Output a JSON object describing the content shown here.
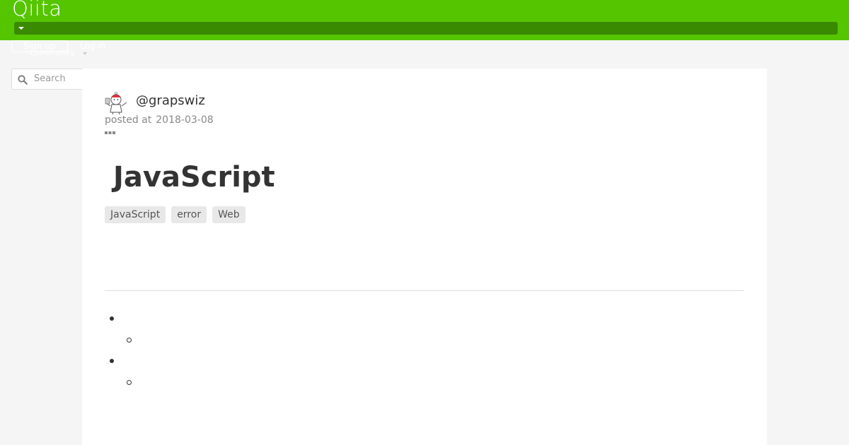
{
  "header": {
    "logo_text": "Qiita",
    "brand_color": "#55c500",
    "signup_label": "Sign up",
    "login_label": "Log in",
    "community_label": "Community"
  },
  "search": {
    "placeholder": "Search",
    "icon": "search-icon"
  },
  "article": {
    "author": "@grapswiz",
    "posted_label": "posted at",
    "posted_date": "2018-03-08",
    "title": "JavaScript",
    "tags": [
      "JavaScript",
      "error",
      "Web"
    ],
    "toc_item_count": 2
  }
}
